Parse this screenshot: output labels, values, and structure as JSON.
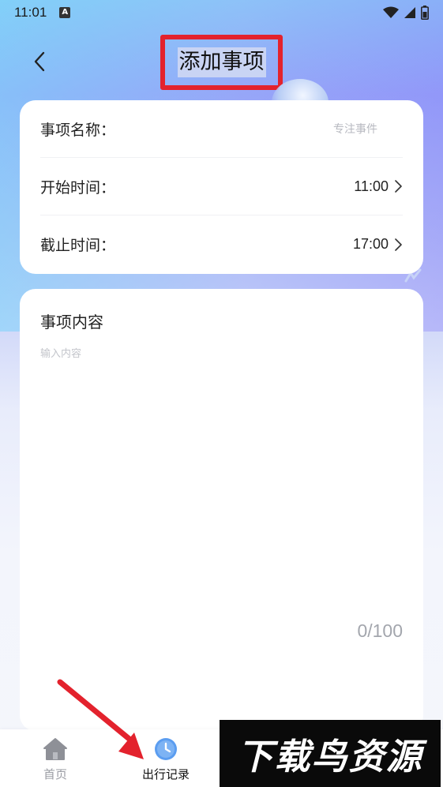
{
  "status_bar": {
    "time": "11:01",
    "notification_icon": "a-icon",
    "icons": [
      "wifi-icon",
      "signal-icon",
      "battery-icon"
    ]
  },
  "header": {
    "title": "添加事项",
    "back_icon": "chevron-left-icon",
    "highlight_color": "#e3222d"
  },
  "info_card": {
    "rows": [
      {
        "label": "事项名称：",
        "placeholder": "专注事件"
      },
      {
        "label": "开始时间：",
        "value": "11:00",
        "icon": "chevron-right-icon"
      },
      {
        "label": "截止时间：",
        "value": "17:00",
        "icon": "chevron-right-icon"
      }
    ]
  },
  "content_card": {
    "title": "事项内容",
    "placeholder": "输入内容",
    "counter": "0/100"
  },
  "tabbar": {
    "tabs": [
      {
        "label": "首页",
        "icon": "home-icon",
        "active": false
      },
      {
        "label": "出行记录",
        "icon": "clock-icon",
        "active": true
      }
    ]
  },
  "watermark": {
    "text": "下载鸟资源"
  },
  "colors": {
    "accent_red": "#e3222d",
    "clock_blue": "#5b9df0",
    "card_bg": "#ffffff"
  }
}
